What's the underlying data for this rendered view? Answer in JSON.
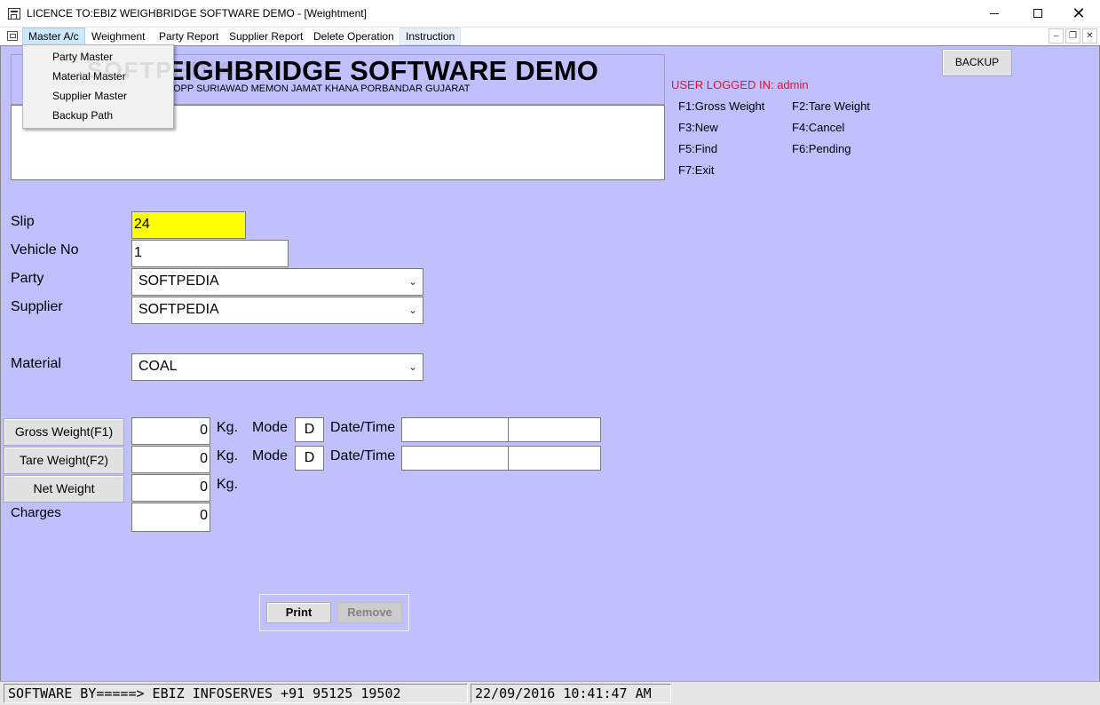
{
  "window": {
    "title": "LICENCE TO:EBIZ WEIGHBRIDGE SOFTWARE DEMO - [Weightment]",
    "minimize": "",
    "maximize": "",
    "close": "✕"
  },
  "menu": {
    "items": [
      "Master A/c",
      "Weighment",
      "Party Report",
      "Supplier Report",
      "Delete Operation",
      "Instruction"
    ],
    "master_dropdown": [
      "Party Master",
      "Material Master",
      "Supplier Master",
      "Backup Path"
    ]
  },
  "mdi_controls": {
    "minimize": "–",
    "restore": "❐",
    "close": "✕"
  },
  "header": {
    "title": "WEIGHBRIDGE SOFTWARE DEMO",
    "title_visible": "EIGHBRIDGE SOFTWARE DEMO",
    "address": "OPP SURIAWAD MEMON JAMAT KHANA PORBANDAR GUJARAT",
    "watermark": "SOFTPEDIA"
  },
  "backup_button": "BACKUP",
  "user_logged_in": "USER LOGGED IN: admin",
  "shortcuts": {
    "f1": "F1:Gross Weight",
    "f2": "F2:Tare Weight",
    "f3": "F3:New",
    "f4": "F4:Cancel",
    "f5": "F5:Find",
    "f6": "F6:Pending",
    "f7": "F7:Exit"
  },
  "form": {
    "slip_label": "Slip",
    "slip_value": "24",
    "vehicle_label": "Vehicle No",
    "vehicle_value": "1",
    "party_label": "Party",
    "party_value": "SOFTPEDIA",
    "supplier_label": "Supplier",
    "supplier_value": "SOFTPEDIA",
    "material_label": "Material",
    "material_value": "COAL"
  },
  "weights": {
    "gross_button": "Gross Weight(F1)",
    "gross_value": "0",
    "tare_button": "Tare Weight(F2)",
    "tare_value": "0",
    "net_button": "Net Weight",
    "net_value": "0",
    "charges_label": "Charges",
    "charges_value": "0",
    "unit": "Kg.",
    "mode_label": "Mode",
    "gross_mode": "D",
    "tare_mode": "D",
    "datetime_label": "Date/Time"
  },
  "actions": {
    "print": "Print",
    "remove": "Remove"
  },
  "status": {
    "software_by": "SOFTWARE BY=====> EBIZ INFOSERVES +91 95125 19502",
    "datetime": "22/09/2016  10:41:47 AM"
  },
  "icons": {
    "app": "app-window-icon",
    "mdi": "mdi-child-icon",
    "combo": "chevron-down-icon"
  },
  "colors": {
    "client_bg": "#c0c0ff",
    "slip_bg": "#ffff00",
    "user_text": "#e8112d",
    "menu_highlight": "#cce8ff"
  },
  "chevron": "⌄"
}
